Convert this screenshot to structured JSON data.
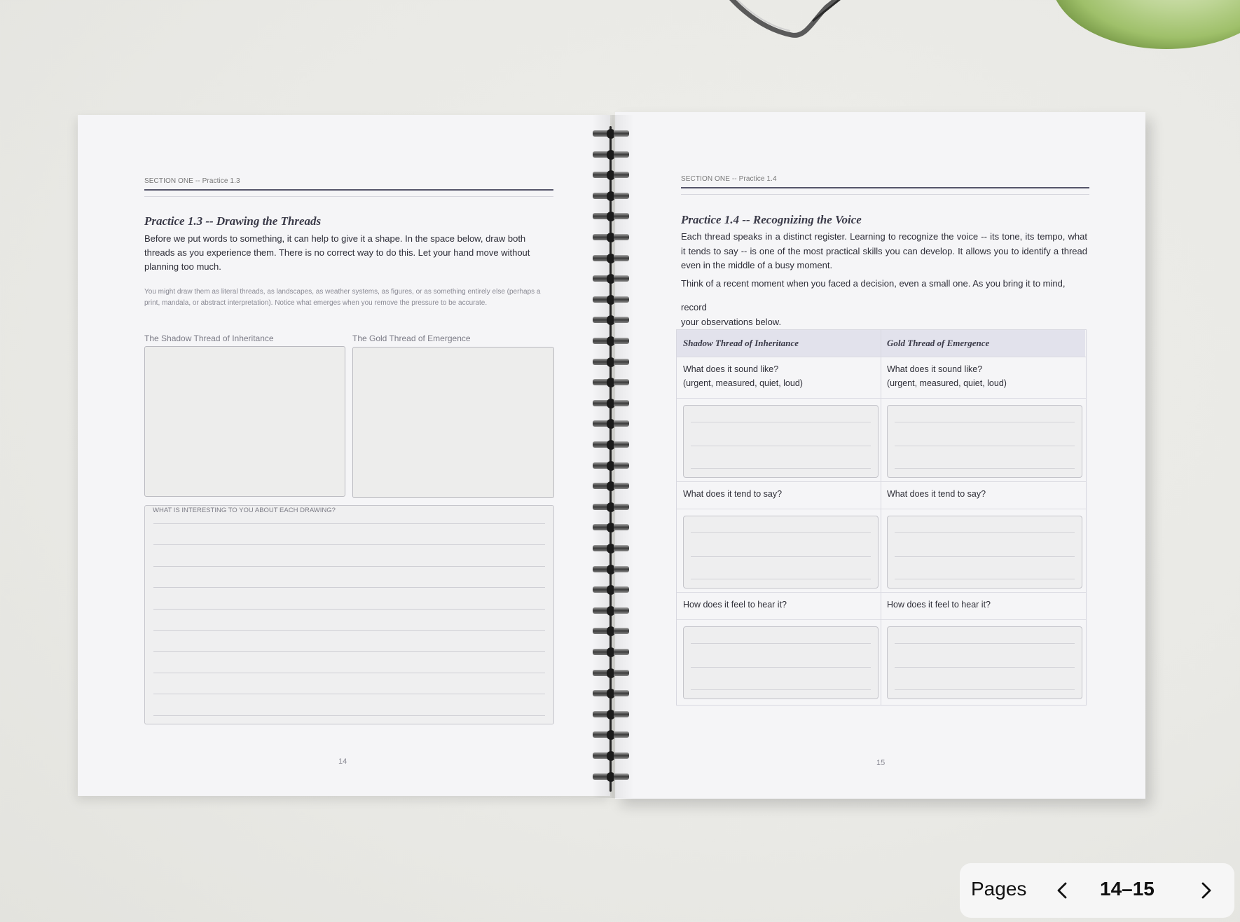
{
  "left_page": {
    "section_label": "SECTION ONE -- Practice 1.3",
    "title": "Practice 1.3 -- Drawing the Threads",
    "intro": "Before we put words to something, it can help to give it a shape. In the space below, draw both threads as you experience them. There is no correct way to do this. Let your hand move without planning too much.",
    "note": "You might draw them as literal threads, as landscapes, as weather systems, as figures, or as something entirely else (perhaps a print, mandala, or abstract interpretation). Notice what emerges when you remove the pressure to be accurate.",
    "box_left_label": "The Shadow Thread of Inheritance",
    "box_right_label": "The Gold Thread of Emergence",
    "reflection_caption": "WHAT IS INTERESTING TO YOU ABOUT EACH DRAWING?",
    "page_number": "14"
  },
  "right_page": {
    "section_label": "SECTION ONE -- Practice 1.4",
    "title": "Practice 1.4 -- Recognizing the Voice",
    "intro": "Each thread speaks in a distinct register. Learning to recognize the voice -- its tone, its tempo, what it tends to say -- is one of the most practical skills you can develop. It allows you to identify a thread even in the middle of a busy moment.",
    "prompt_line": "Think of a recent moment when you faced a decision, even a small one. As you bring it to mind,",
    "prompt_record": "record",
    "prompt_below": "your observations below.",
    "table": {
      "col_left": "Shadow Thread of Inheritance",
      "col_right": "Gold Thread of Emergence",
      "rows": [
        {
          "left_q1": "What does it sound like?",
          "left_q2": "(urgent, measured, quiet, loud)",
          "right_q1": "What does it sound like?",
          "right_q2": "(urgent, measured, quiet, loud)"
        },
        {
          "left_q1": "What does it tend to say?",
          "right_q1": "What does it tend to say?"
        },
        {
          "left_q1": "How does it feel to hear it?",
          "right_q1": "How does it feel to hear it?"
        }
      ]
    },
    "page_number": "15"
  },
  "nav": {
    "label": "Pages",
    "current": "14–15",
    "prev_icon": "chevron-left-icon",
    "next_icon": "chevron-right-icon"
  }
}
